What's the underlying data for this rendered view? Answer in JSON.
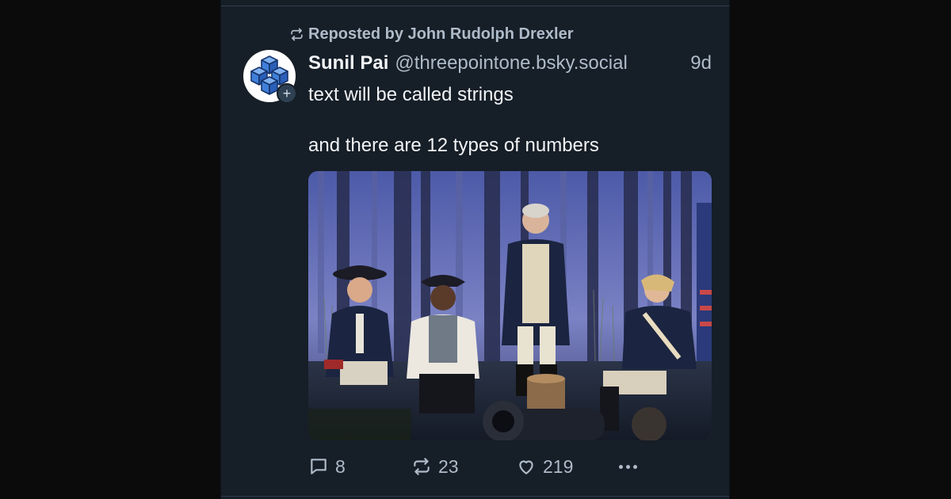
{
  "repost": {
    "label": "Reposted by John Rudolph Drexler"
  },
  "post": {
    "author_name": "Sunil Pai",
    "author_handle": "@threepointone.bsky.social",
    "timestamp": "9d",
    "text_lines": [
      "text will be called strings",
      "and there are 12 types of numbers"
    ]
  },
  "stats": {
    "replies": "8",
    "reposts": "23",
    "likes": "219"
  },
  "colors": {
    "background": "#161e27",
    "muted_text": "#aebbc9",
    "primary_text": "#f1f3f5",
    "divider": "#2e4052"
  },
  "icons": {
    "repost_indicator": "repost-icon",
    "avatar_follow": "plus-icon",
    "reply": "speech-bubble-icon",
    "repost": "repost-icon",
    "like": "heart-icon",
    "more": "ellipsis-icon"
  }
}
